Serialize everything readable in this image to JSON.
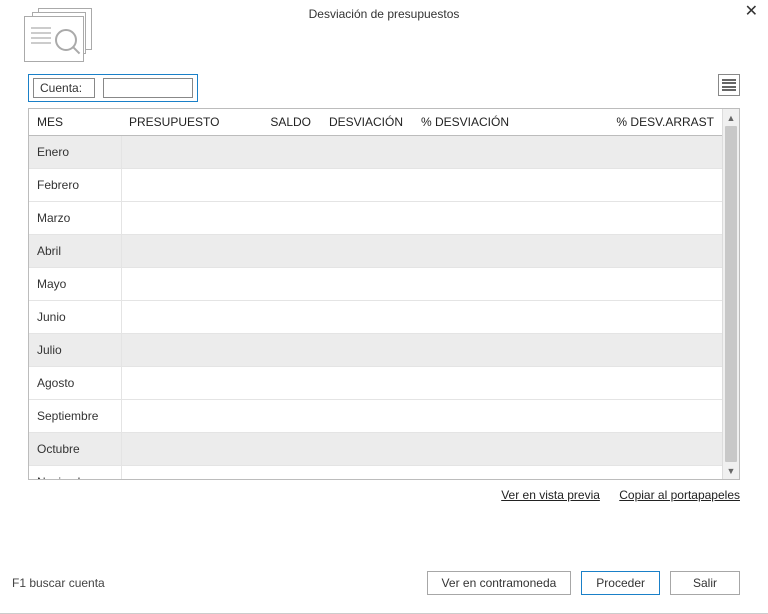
{
  "window": {
    "title": "Desviación de presupuestos"
  },
  "filter": {
    "label": "Cuenta:",
    "value": ""
  },
  "table": {
    "headers": {
      "mes": "MES",
      "presupuesto": "PRESUPUESTO",
      "saldo": "SALDO",
      "desviacion": "DESVIACIÓN",
      "pct_desviacion": "% DESVIACIÓN",
      "pct_arrast": "% DESV.ARRAST"
    },
    "rows": [
      {
        "mes": "Enero"
      },
      {
        "mes": "Febrero"
      },
      {
        "mes": "Marzo"
      },
      {
        "mes": "Abril"
      },
      {
        "mes": "Mayo"
      },
      {
        "mes": "Junio"
      },
      {
        "mes": "Julio"
      },
      {
        "mes": "Agosto"
      },
      {
        "mes": "Septiembre"
      },
      {
        "mes": "Octubre"
      },
      {
        "mes": "Noviembre"
      }
    ]
  },
  "links": {
    "preview": "Ver en vista previa",
    "clipboard": "Copiar al portapapeles"
  },
  "footer": {
    "hint": "F1 buscar cuenta",
    "contramoneda": "Ver en contramoneda",
    "proceder": "Proceder",
    "salir": "Salir"
  }
}
